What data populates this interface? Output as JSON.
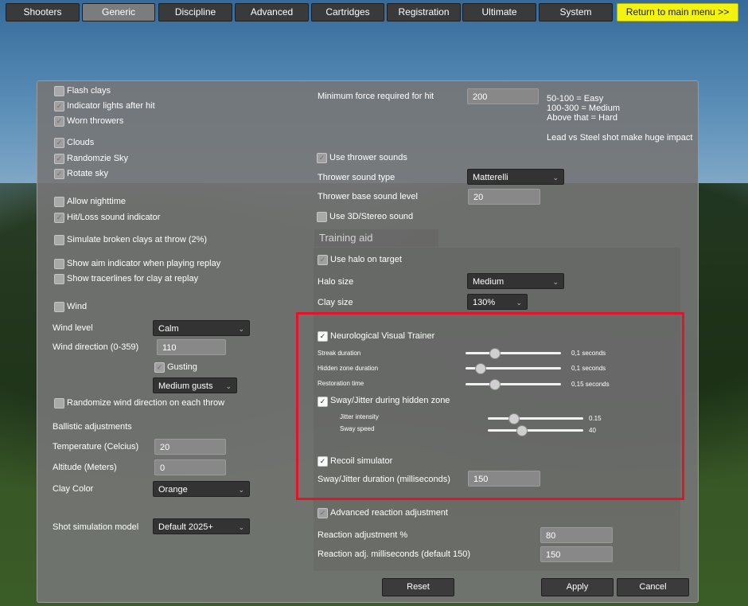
{
  "nav": {
    "tabs": [
      "Shooters",
      "Generic",
      "Discipline",
      "Advanced",
      "Cartridges",
      "Registration",
      "Ultimate",
      "System"
    ],
    "active_tab": "Generic",
    "return_label": "Return to main menu >>"
  },
  "left": {
    "flash_clays": "Flash clays",
    "indicator_lights": "Indicator lights after hit",
    "worn_throwers": "Worn throwers",
    "clouds": "Clouds",
    "randomize_sky": "Randomzie Sky",
    "rotate_sky": "Rotate sky",
    "allow_nighttime": "Allow nighttime",
    "hit_loss_sound": "Hit/Loss sound indicator",
    "simulate_broken": "Simulate broken clays at throw (2%)",
    "show_aim": "Show aim indicator when playing replay",
    "show_tracer": "Show tracerlines for clay at replay",
    "wind": "Wind",
    "wind_level_label": "Wind level",
    "wind_level_value": "Calm",
    "wind_direction_label": "Wind direction (0-359)",
    "wind_direction_value": "110",
    "gusting": "Gusting",
    "gusts_value": "Medium gusts",
    "randomize_wind": "Randomize wind direction on each throw",
    "ballistic": "Ballistic adjustments",
    "temperature_label": "Temperature (Celcius)",
    "temperature_value": "20",
    "altitude_label": "Altitude (Meters)",
    "altitude_value": "0",
    "clay_color_label": "Clay Color",
    "clay_color_value": "Orange",
    "shot_model_label": "Shot simulation model",
    "shot_model_value": "Default 2025+"
  },
  "right": {
    "min_force_label": "Minimum force required for hit",
    "min_force_value": "200",
    "note1": "50-100 = Easy",
    "note2": "100-300 = Medium",
    "note3": "Above that = Hard",
    "note4": "Lead vs Steel shot make huge impact",
    "use_thrower_sounds": "Use thrower sounds",
    "thrower_sound_type_label": "Thrower sound type",
    "thrower_sound_type_value": "Matterelli",
    "thrower_base_label": "Thrower base sound level",
    "thrower_base_value": "20",
    "use_3d": "Use 3D/Stereo sound",
    "training_aid": "Training aid",
    "use_halo": "Use halo on target",
    "halo_size_label": "Halo size",
    "halo_size_value": "Medium",
    "clay_size_label": "Clay size",
    "clay_size_value": "130%",
    "nvt": "Neurological Visual Trainer",
    "streak_label": "Streak duration",
    "streak_value": "0,1 seconds",
    "streak_level": 0.3,
    "hidden_label": "Hidden zone duration",
    "hidden_value": "0,1 seconds",
    "hidden_level": 0.15,
    "restoration_label": "Restoration time",
    "restoration_value": "0,15 seconds",
    "restoration_level": 0.3,
    "sway": "Sway/Jitter during hidden zone",
    "jitter_label": "Jitter intensity",
    "jitter_value": "0.15",
    "jitter_level": 0.27,
    "sway_speed_label": "Sway speed",
    "sway_speed_value": "40",
    "sway_speed_level": 0.35,
    "recoil": "Recoil simulator",
    "sway_duration_label": "Sway/Jitter duration (milliseconds)",
    "sway_duration_value": "150",
    "adv_reaction": "Advanced reaction adjustment",
    "reaction_pct_label": "Reaction adjustment %",
    "reaction_pct_value": "80",
    "reaction_ms_label": "Reaction adj. milliseconds (default 150)",
    "reaction_ms_value": "150"
  },
  "footer": {
    "reset": "Reset",
    "apply": "Apply",
    "cancel": "Cancel"
  },
  "colors": {
    "highlight": "#e0152a",
    "return_button": "#f3f30e"
  },
  "icons": {
    "check": "✓",
    "chevron": "⌄"
  }
}
